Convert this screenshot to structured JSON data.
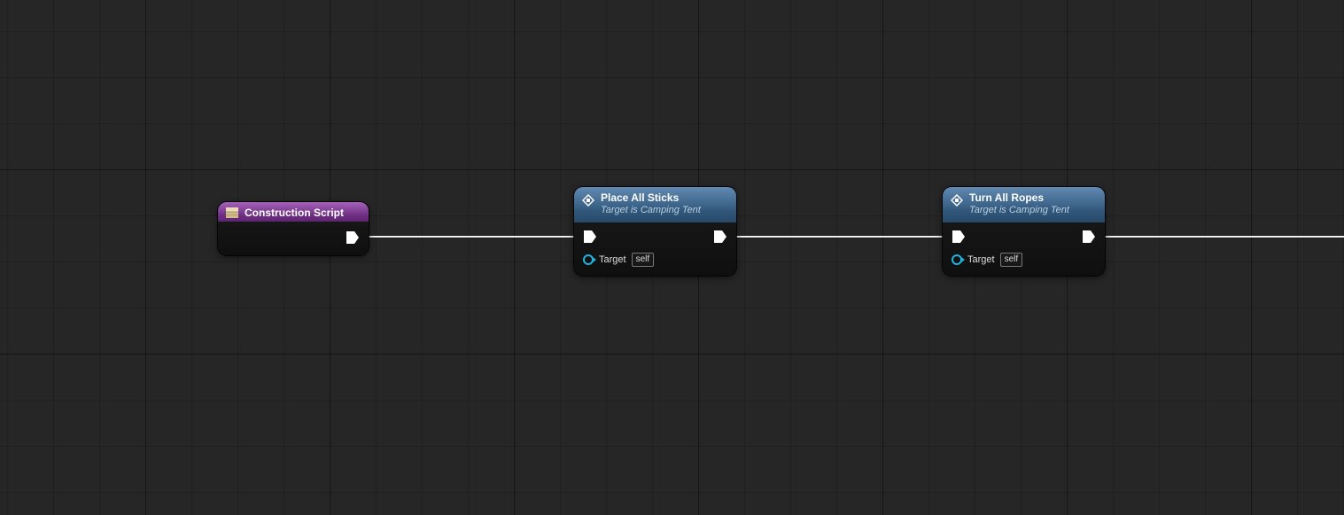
{
  "nodes": {
    "construction": {
      "title": "Construction Script"
    },
    "place_sticks": {
      "title": "Place All Sticks",
      "subtitle": "Target is Camping Tent",
      "target_label": "Target",
      "target_value": "self"
    },
    "turn_ropes": {
      "title": "Turn All Ropes",
      "subtitle": "Target is Camping Tent",
      "target_label": "Target",
      "target_value": "self"
    }
  }
}
